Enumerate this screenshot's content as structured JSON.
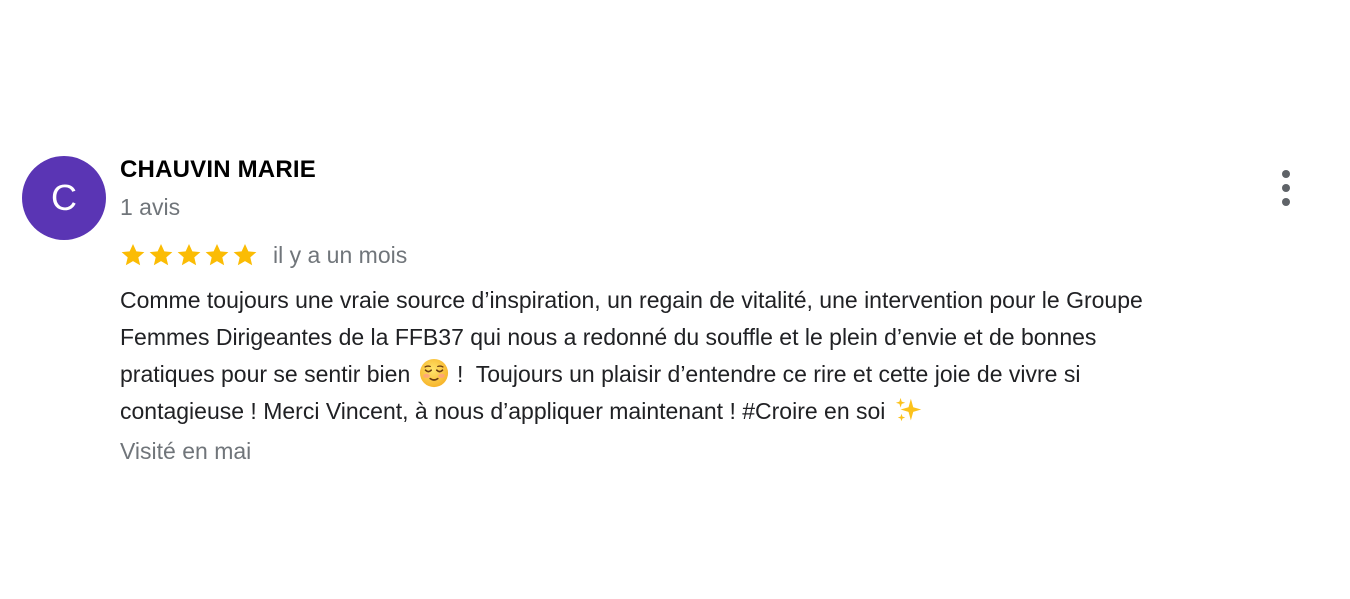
{
  "review": {
    "author": {
      "initial": "C",
      "name": "CHAUVIN MARIE",
      "review_count": "1 avis",
      "avatar_color": "#5a35b4"
    },
    "menu_icon": "more-vert-icon",
    "rating": {
      "stars": 5,
      "max": 5,
      "star_color": "#fbbc04",
      "time_ago": "il y a un mois"
    },
    "text": {
      "line1": "Comme toujours une vraie source d’inspiration, un regain de vitalité, une intervention pour le Groupe",
      "line2": "Femmes Dirigeantes de la FFB37 qui nous a redonné du souffle et le plein d’envie et de bonnes",
      "line3_before_emoji": "pratiques pour se sentir bien ",
      "line3_emoji": "relieved-face-emoji",
      "line3_after_emoji": " !  Toujours un plaisir d’entendre ce rire et cette joie de vivre si",
      "line4_before_emoji": "contagieuse ! Merci Vincent, à nous d’appliquer maintenant ! #Croire en soi ",
      "line4_emoji": "sparkles-emoji"
    },
    "visited": "Visité en mai"
  }
}
